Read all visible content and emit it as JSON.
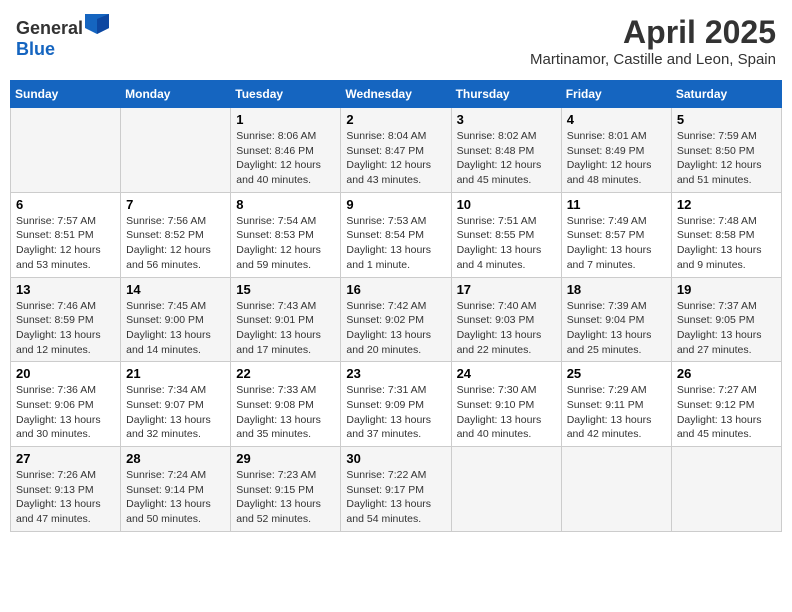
{
  "header": {
    "logo_general": "General",
    "logo_blue": "Blue",
    "month": "April 2025",
    "location": "Martinamor, Castille and Leon, Spain"
  },
  "days_of_week": [
    "Sunday",
    "Monday",
    "Tuesday",
    "Wednesday",
    "Thursday",
    "Friday",
    "Saturday"
  ],
  "weeks": [
    [
      {
        "day": "",
        "info": ""
      },
      {
        "day": "",
        "info": ""
      },
      {
        "day": "1",
        "info": "Sunrise: 8:06 AM\nSunset: 8:46 PM\nDaylight: 12 hours and 40 minutes."
      },
      {
        "day": "2",
        "info": "Sunrise: 8:04 AM\nSunset: 8:47 PM\nDaylight: 12 hours and 43 minutes."
      },
      {
        "day": "3",
        "info": "Sunrise: 8:02 AM\nSunset: 8:48 PM\nDaylight: 12 hours and 45 minutes."
      },
      {
        "day": "4",
        "info": "Sunrise: 8:01 AM\nSunset: 8:49 PM\nDaylight: 12 hours and 48 minutes."
      },
      {
        "day": "5",
        "info": "Sunrise: 7:59 AM\nSunset: 8:50 PM\nDaylight: 12 hours and 51 minutes."
      }
    ],
    [
      {
        "day": "6",
        "info": "Sunrise: 7:57 AM\nSunset: 8:51 PM\nDaylight: 12 hours and 53 minutes."
      },
      {
        "day": "7",
        "info": "Sunrise: 7:56 AM\nSunset: 8:52 PM\nDaylight: 12 hours and 56 minutes."
      },
      {
        "day": "8",
        "info": "Sunrise: 7:54 AM\nSunset: 8:53 PM\nDaylight: 12 hours and 59 minutes."
      },
      {
        "day": "9",
        "info": "Sunrise: 7:53 AM\nSunset: 8:54 PM\nDaylight: 13 hours and 1 minute."
      },
      {
        "day": "10",
        "info": "Sunrise: 7:51 AM\nSunset: 8:55 PM\nDaylight: 13 hours and 4 minutes."
      },
      {
        "day": "11",
        "info": "Sunrise: 7:49 AM\nSunset: 8:57 PM\nDaylight: 13 hours and 7 minutes."
      },
      {
        "day": "12",
        "info": "Sunrise: 7:48 AM\nSunset: 8:58 PM\nDaylight: 13 hours and 9 minutes."
      }
    ],
    [
      {
        "day": "13",
        "info": "Sunrise: 7:46 AM\nSunset: 8:59 PM\nDaylight: 13 hours and 12 minutes."
      },
      {
        "day": "14",
        "info": "Sunrise: 7:45 AM\nSunset: 9:00 PM\nDaylight: 13 hours and 14 minutes."
      },
      {
        "day": "15",
        "info": "Sunrise: 7:43 AM\nSunset: 9:01 PM\nDaylight: 13 hours and 17 minutes."
      },
      {
        "day": "16",
        "info": "Sunrise: 7:42 AM\nSunset: 9:02 PM\nDaylight: 13 hours and 20 minutes."
      },
      {
        "day": "17",
        "info": "Sunrise: 7:40 AM\nSunset: 9:03 PM\nDaylight: 13 hours and 22 minutes."
      },
      {
        "day": "18",
        "info": "Sunrise: 7:39 AM\nSunset: 9:04 PM\nDaylight: 13 hours and 25 minutes."
      },
      {
        "day": "19",
        "info": "Sunrise: 7:37 AM\nSunset: 9:05 PM\nDaylight: 13 hours and 27 minutes."
      }
    ],
    [
      {
        "day": "20",
        "info": "Sunrise: 7:36 AM\nSunset: 9:06 PM\nDaylight: 13 hours and 30 minutes."
      },
      {
        "day": "21",
        "info": "Sunrise: 7:34 AM\nSunset: 9:07 PM\nDaylight: 13 hours and 32 minutes."
      },
      {
        "day": "22",
        "info": "Sunrise: 7:33 AM\nSunset: 9:08 PM\nDaylight: 13 hours and 35 minutes."
      },
      {
        "day": "23",
        "info": "Sunrise: 7:31 AM\nSunset: 9:09 PM\nDaylight: 13 hours and 37 minutes."
      },
      {
        "day": "24",
        "info": "Sunrise: 7:30 AM\nSunset: 9:10 PM\nDaylight: 13 hours and 40 minutes."
      },
      {
        "day": "25",
        "info": "Sunrise: 7:29 AM\nSunset: 9:11 PM\nDaylight: 13 hours and 42 minutes."
      },
      {
        "day": "26",
        "info": "Sunrise: 7:27 AM\nSunset: 9:12 PM\nDaylight: 13 hours and 45 minutes."
      }
    ],
    [
      {
        "day": "27",
        "info": "Sunrise: 7:26 AM\nSunset: 9:13 PM\nDaylight: 13 hours and 47 minutes."
      },
      {
        "day": "28",
        "info": "Sunrise: 7:24 AM\nSunset: 9:14 PM\nDaylight: 13 hours and 50 minutes."
      },
      {
        "day": "29",
        "info": "Sunrise: 7:23 AM\nSunset: 9:15 PM\nDaylight: 13 hours and 52 minutes."
      },
      {
        "day": "30",
        "info": "Sunrise: 7:22 AM\nSunset: 9:17 PM\nDaylight: 13 hours and 54 minutes."
      },
      {
        "day": "",
        "info": ""
      },
      {
        "day": "",
        "info": ""
      },
      {
        "day": "",
        "info": ""
      }
    ]
  ]
}
